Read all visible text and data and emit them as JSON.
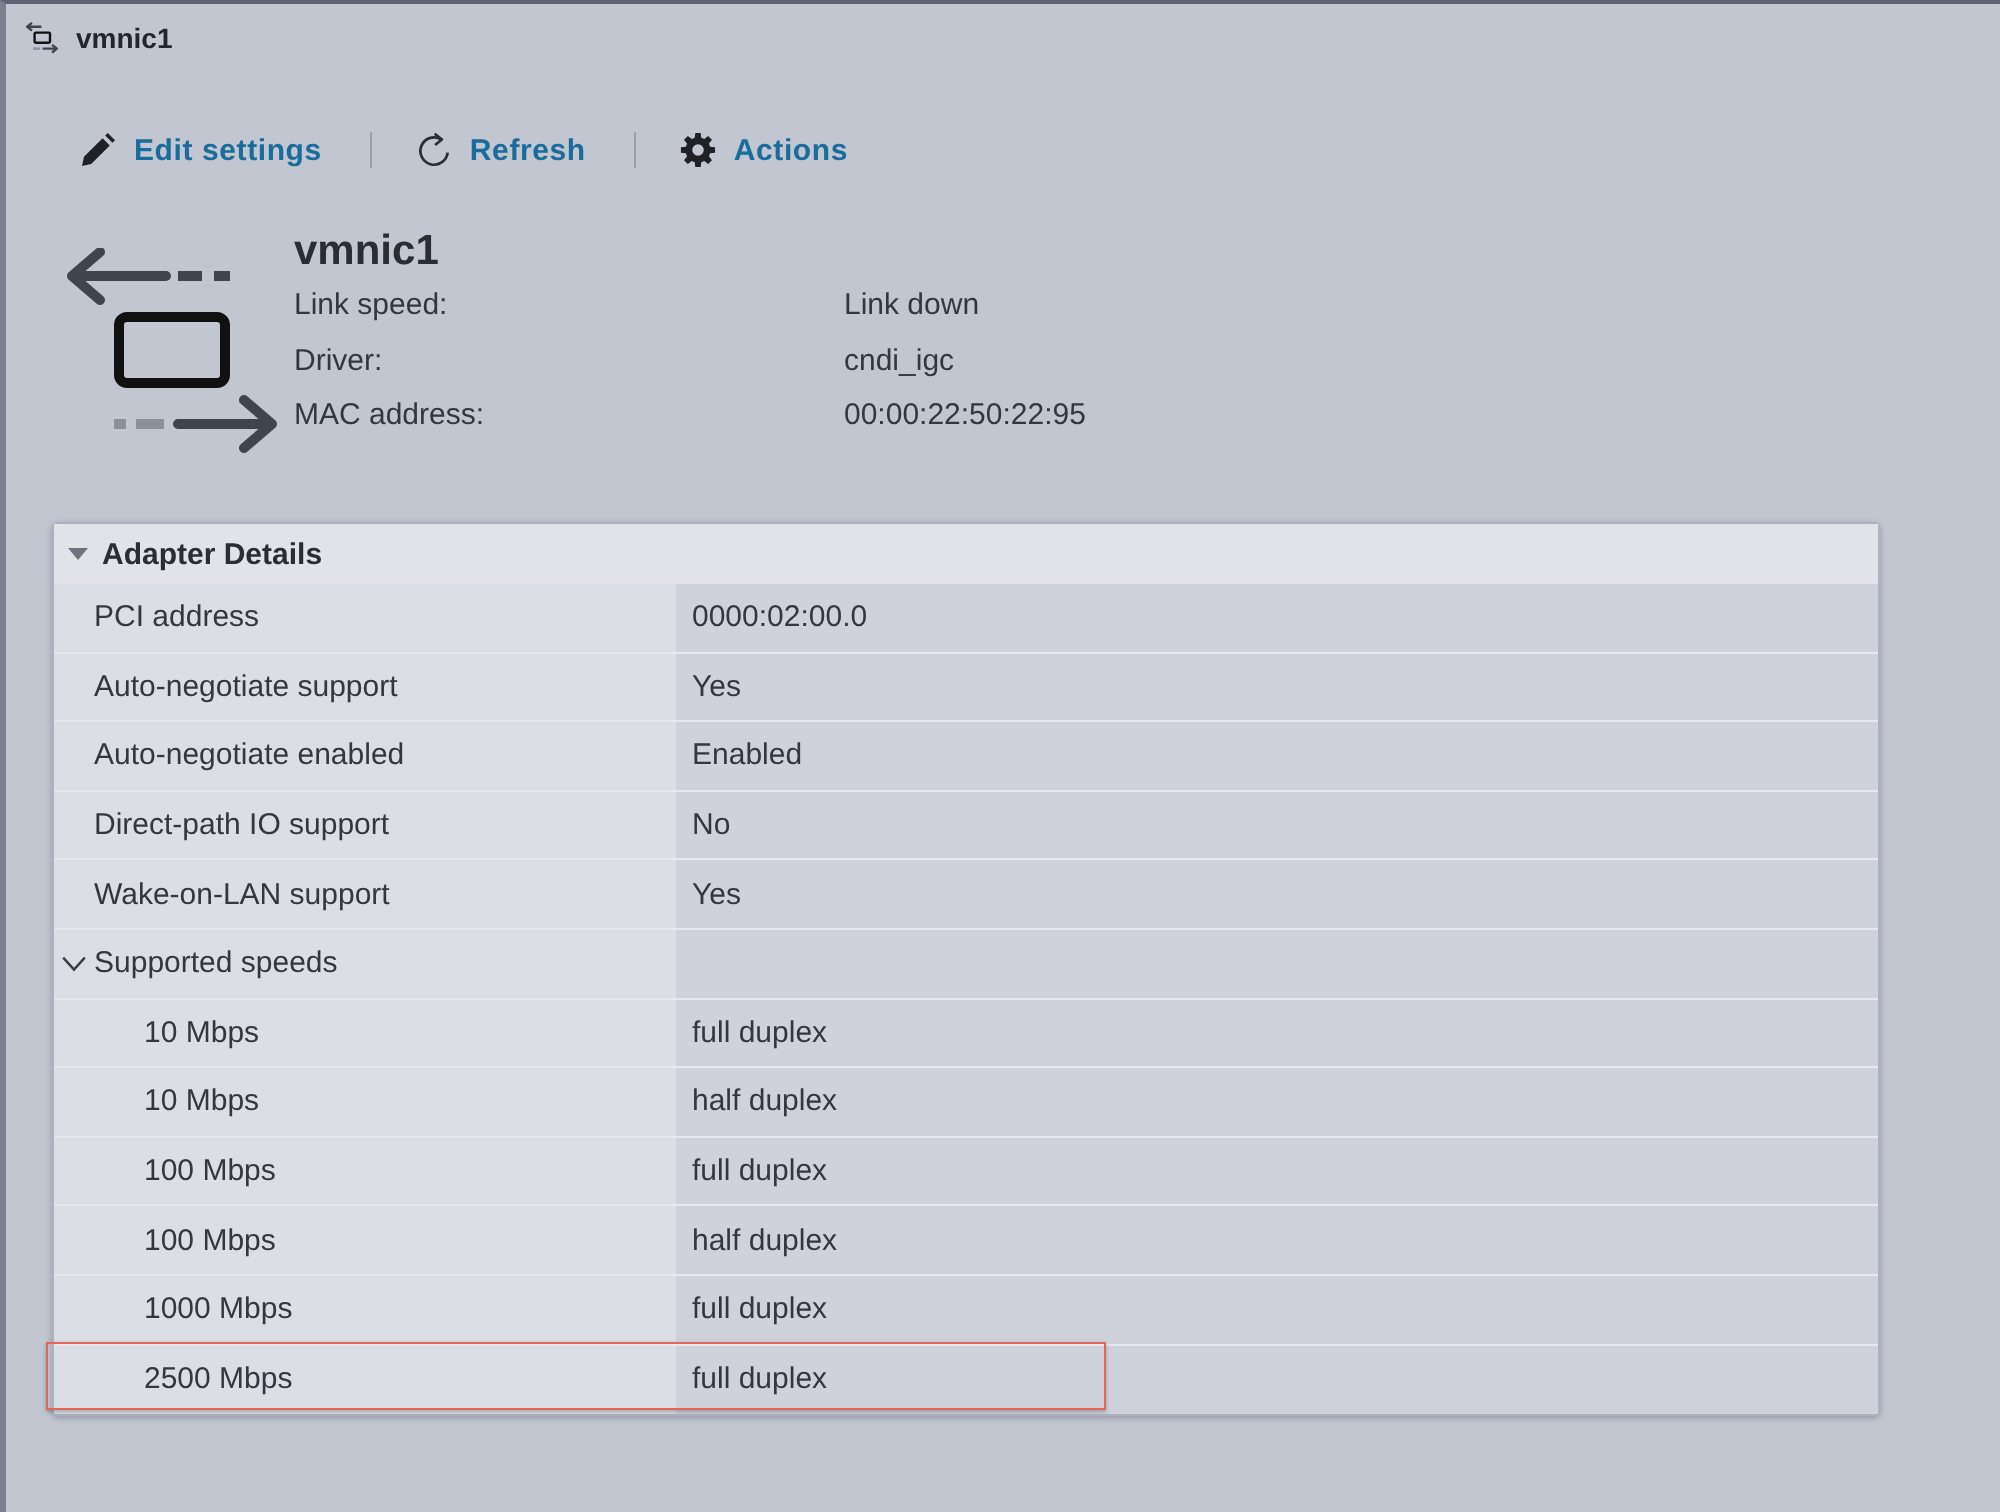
{
  "window": {
    "title": "vmnic1"
  },
  "toolbar": [
    {
      "label": "Edit settings",
      "kind": "edit"
    },
    {
      "label": "Refresh",
      "kind": "refresh"
    },
    {
      "label": "Actions",
      "kind": "actions"
    }
  ],
  "summary": {
    "name": "vmnic1",
    "fields": [
      {
        "label": "Link speed:",
        "value": "Link down"
      },
      {
        "label": "Driver:",
        "value": "cndi_igc"
      },
      {
        "label": "MAC address:",
        "value": "00:00:22:50:22:95"
      }
    ]
  },
  "adapter_details": {
    "title": "Adapter Details",
    "expanded": true,
    "rows": [
      {
        "label": "PCI address",
        "value": "0000:02:00.0"
      },
      {
        "label": "Auto-negotiate support",
        "value": "Yes"
      },
      {
        "label": "Auto-negotiate enabled",
        "value": "Enabled"
      },
      {
        "label": "Direct-path IO support",
        "value": "No"
      },
      {
        "label": "Wake-on-LAN support",
        "value": "Yes"
      },
      {
        "label": "Supported speeds",
        "expanded": true,
        "children": [
          {
            "label": "10 Mbps",
            "value": "full duplex",
            "highlighted": false
          },
          {
            "label": "10 Mbps",
            "value": "half duplex",
            "highlighted": false
          },
          {
            "label": "100 Mbps",
            "value": "full duplex",
            "highlighted": false
          },
          {
            "label": "100 Mbps",
            "value": "half duplex",
            "highlighted": false
          },
          {
            "label": "1000 Mbps",
            "value": "full duplex",
            "highlighted": false
          },
          {
            "label": "2500 Mbps",
            "value": "full duplex",
            "highlighted": true
          }
        ]
      }
    ]
  }
}
